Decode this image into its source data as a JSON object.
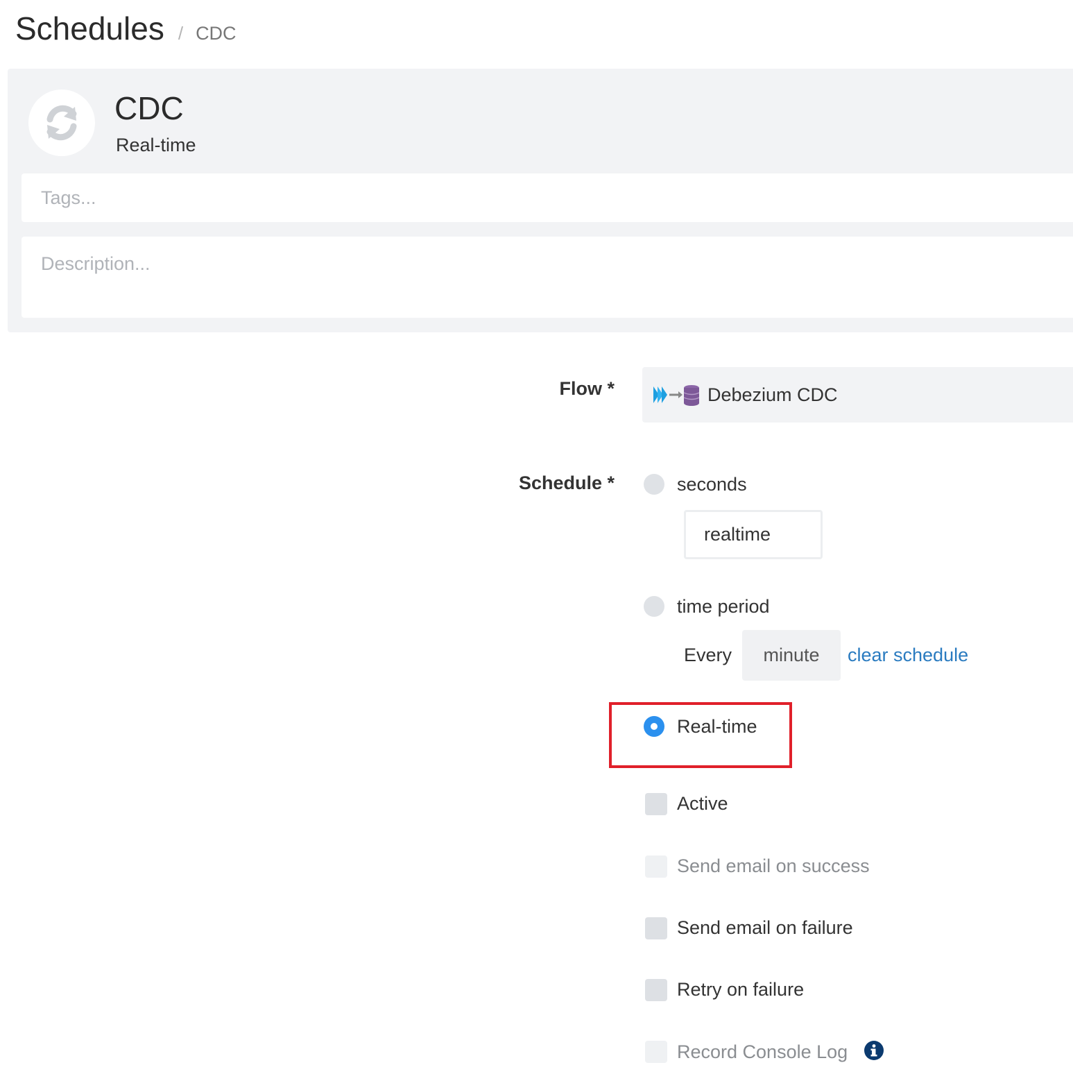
{
  "breadcrumb": {
    "title": "Schedules",
    "separator": "/",
    "current": "CDC"
  },
  "header": {
    "icon": "refresh-icon",
    "title": "CDC",
    "subtitle": "Real-time"
  },
  "tags": {
    "placeholder": "Tags..."
  },
  "description": {
    "placeholder": "Description..."
  },
  "flow": {
    "label": "Flow *",
    "icon": "debezium-flow-icon",
    "value": "Debezium CDC"
  },
  "schedule": {
    "label": "Schedule *",
    "options": {
      "seconds": {
        "label": "seconds",
        "selected": false,
        "value": "realtime"
      },
      "time_period": {
        "label": "time period",
        "selected": false,
        "every_label": "Every",
        "period_value": "minute",
        "clear_label": "clear schedule"
      },
      "realtime": {
        "label": "Real-time",
        "selected": true
      }
    }
  },
  "checkboxes": {
    "active": {
      "label": "Active",
      "checked": false,
      "enabled": true
    },
    "email_success": {
      "label": "Send email on success",
      "checked": false,
      "enabled": false
    },
    "email_failure": {
      "label": "Send email on failure",
      "checked": false,
      "enabled": true
    },
    "retry_failure": {
      "label": "Retry on failure",
      "checked": false,
      "enabled": true
    },
    "record_console_log": {
      "label": "Record Console Log",
      "checked": false,
      "enabled": false,
      "info_icon": "info-icon"
    }
  },
  "colors": {
    "accent": "#2b90ee",
    "link": "#2a7bc0",
    "highlight": "#e0202a",
    "panel": "#f2f3f5",
    "info": "#0b3a6f"
  }
}
